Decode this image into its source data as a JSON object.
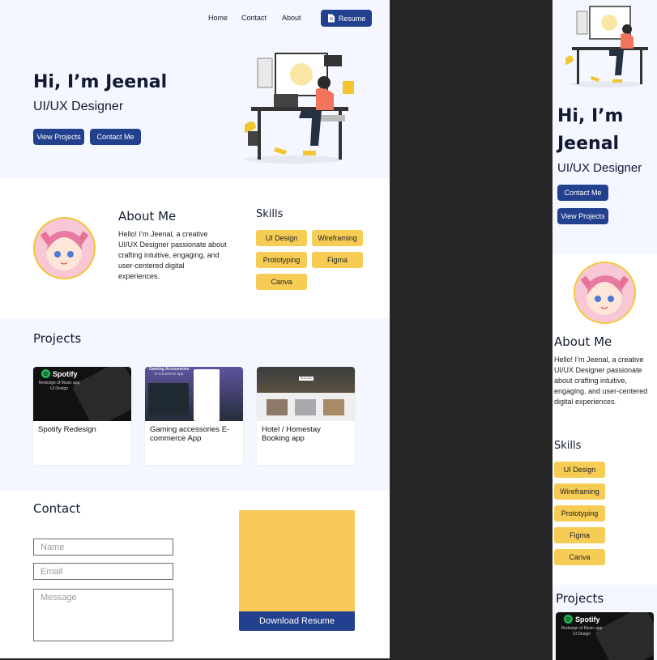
{
  "nav": {
    "home": "Home",
    "contact": "Contact",
    "about": "About",
    "resume": "Resume"
  },
  "hero": {
    "greeting": "Hi, I’m Jeenal",
    "greeting_line1": "Hi, I’m",
    "greeting_line2": "Jeenal",
    "role": "UI/UX Designer",
    "view_projects": "View Projects",
    "contact_me": "Contact Me"
  },
  "about": {
    "title": "About Me",
    "text": "Hello! I’m Jeenal, a creative UI/UX Designer passionate about crafting intuitive, engaging, and user-centered digital experiences."
  },
  "skills": {
    "title": "Skills",
    "items": [
      "UI Design",
      "Wireframing",
      "Prototyping",
      "Figma",
      "Canva"
    ]
  },
  "projects": {
    "title": "Projects",
    "items": [
      {
        "title": "Spotify Redesign",
        "brand": "Spotify",
        "caption": "Redesign of Music app UI Design"
      },
      {
        "title": "Gaming accessories E-commerce App",
        "banner": "Gaming Accessories",
        "sub": "E-Commerce app"
      },
      {
        "title": "Hotel / Homestay Booking app",
        "book_label": "Book Now"
      }
    ]
  },
  "contact": {
    "title": "Contact",
    "name_placeholder": "Name",
    "email_placeholder": "Email",
    "message_placeholder": "Message",
    "download": "Download Resume"
  },
  "colors": {
    "accent": "#23408e",
    "chip": "#f6cc55",
    "section_bg": "#f4f7ff",
    "resume_card": "#f6c95a",
    "illustration_yellow": "#f4c531"
  },
  "icons": [
    "document-icon",
    "spotify-logo-icon",
    "avatar-portrait",
    "designer-illustration"
  ]
}
